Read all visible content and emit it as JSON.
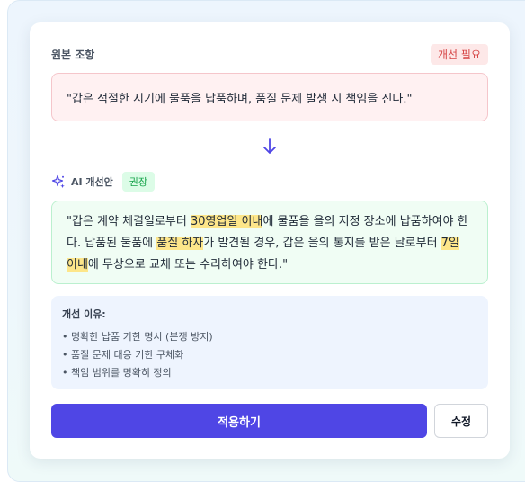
{
  "original": {
    "label": "원본 조항",
    "badge": "개선 필요",
    "text": "\"갑은 적절한 시기에 물품을 납품하며, 품질 문제 발생 시 책임을 진다.\""
  },
  "arrow_icon": "arrow-down-icon",
  "improved": {
    "label": "AI 개선안",
    "badge": "권장",
    "icon": "sparkle-icon",
    "segments": [
      "\"갑은 계약 체결일로부터 ",
      "30영업일 이내",
      "에 물품을 을의 지정 장소에 납품하여야 한다. 납품된 물품에 ",
      "품질 하자",
      "가 발견될 경우, 갑은 을의 통지를 받은 날로부터 ",
      "7일 이내",
      "에 무상으로 교체 또는 수리하여야 한다.\""
    ]
  },
  "reason": {
    "title": "개선 이유:",
    "items": [
      "• 명확한 납품 기한 명시 (분쟁 방지)",
      "• 품질 문제 대응 기한 구체화",
      "• 책임 범위를 명확히 정의"
    ]
  },
  "actions": {
    "apply_label": "적용하기",
    "edit_label": "수정"
  },
  "colors": {
    "accent": "#4f46e5",
    "highlight": "#fde68a",
    "warning": "#d64545",
    "success": "#16a34a"
  }
}
